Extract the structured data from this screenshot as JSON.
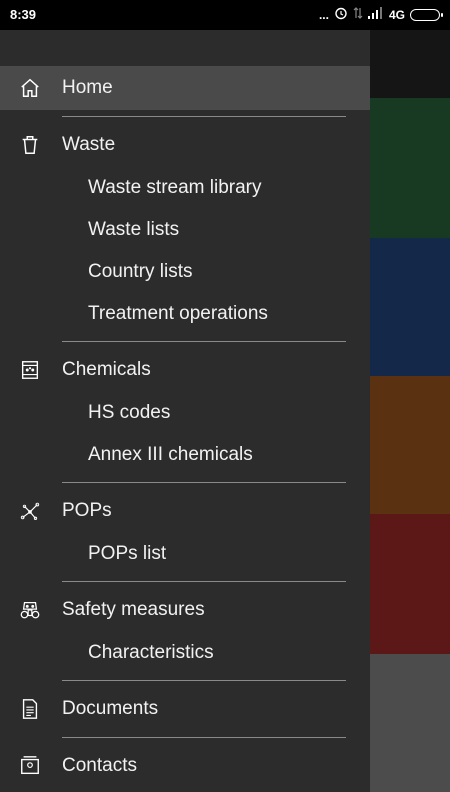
{
  "status": {
    "time": "8:39",
    "network": "4G",
    "dots": "..."
  },
  "drawer": {
    "items": [
      {
        "label": "Home",
        "icon": "home-icon",
        "active": true
      },
      {
        "label": "Waste",
        "icon": "trash-icon",
        "children": [
          "Waste stream library",
          "Waste lists",
          "Country lists",
          "Treatment operations"
        ]
      },
      {
        "label": "Chemicals",
        "icon": "chemical-barrel-icon",
        "children": [
          "HS codes",
          "Annex III chemicals"
        ]
      },
      {
        "label": "POPs",
        "icon": "molecule-icon",
        "children": [
          "POPs list"
        ]
      },
      {
        "label": "Safety measures",
        "icon": "gas-mask-icon",
        "children": [
          "Characteristics"
        ]
      },
      {
        "label": "Documents",
        "icon": "document-icon"
      },
      {
        "label": "Contacts",
        "icon": "contacts-icon"
      }
    ]
  },
  "background_colors": [
    "#151515",
    "#183a22",
    "#14284a",
    "#5a3212",
    "#5c1816",
    "#4c4c4c"
  ]
}
